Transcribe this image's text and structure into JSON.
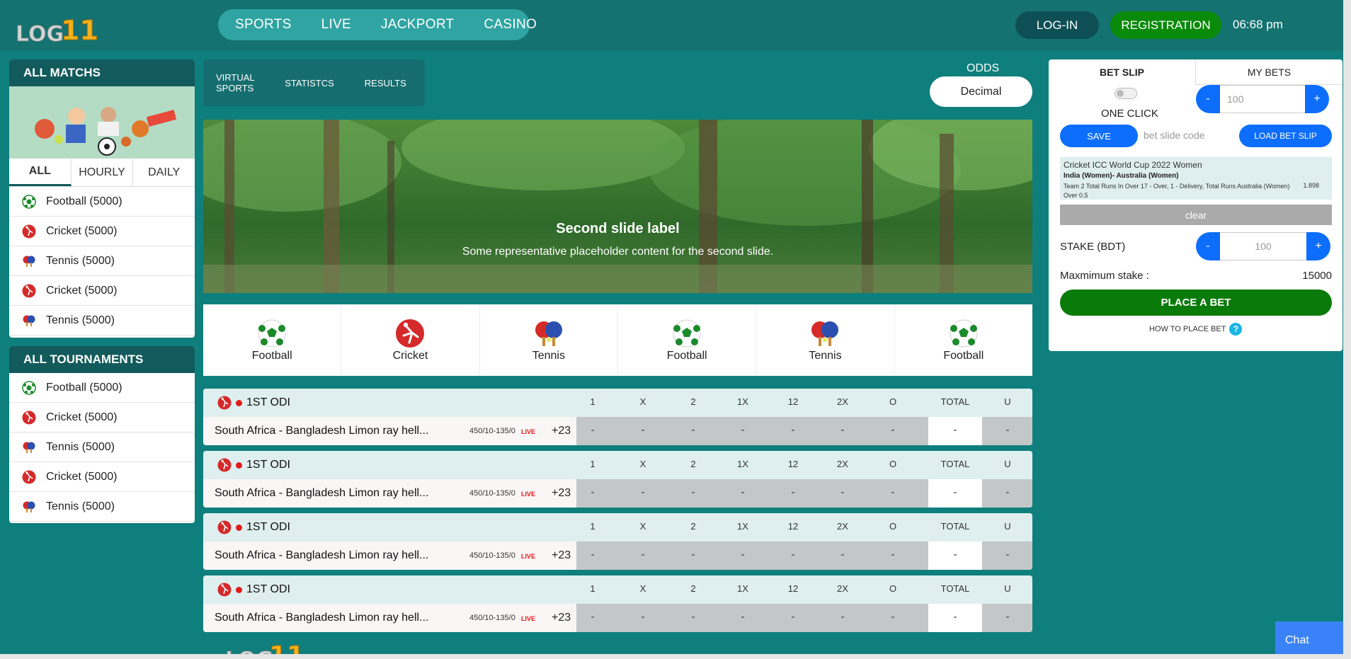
{
  "header": {
    "logo_text": "LOG11",
    "nav": [
      "SPORTS",
      "LIVE",
      "JACKPORT",
      "CASINO"
    ],
    "login": "LOG-IN",
    "register": "REGISTRATION",
    "time": "06:68 pm"
  },
  "sidebar": {
    "all_matchs": {
      "title": "ALL MATCHS",
      "tabs": [
        "ALL",
        "HOURLY",
        "DAILY"
      ],
      "items": [
        "Football (5000)",
        "Cricket (5000)",
        "Tennis (5000)",
        "Cricket (5000)",
        "Tennis (5000)"
      ]
    },
    "all_tournaments": {
      "title": "ALL TOURNAMENTS",
      "items": [
        "Football (5000)",
        "Cricket (5000)",
        "Tennis (5000)",
        "Cricket (5000)",
        "Tennis (5000)"
      ]
    }
  },
  "subtabs": [
    "VIRTUAL SPORTS",
    "STATISTCS",
    "RESULTS"
  ],
  "odds": {
    "label": "ODDS",
    "value": "Decimal"
  },
  "banner": {
    "title": "Second slide label",
    "subtitle": "Some representative placeholder content for the second slide."
  },
  "sports_bar": [
    {
      "label": "Football",
      "icon": "football-icon"
    },
    {
      "label": "Cricket",
      "icon": "cricket-icon"
    },
    {
      "label": "Tennis",
      "icon": "tennis-icon"
    },
    {
      "label": "Football",
      "icon": "football-icon"
    },
    {
      "label": "Tennis",
      "icon": "tennis-icon"
    },
    {
      "label": "Football",
      "icon": "football-icon"
    }
  ],
  "match_columns": [
    "1",
    "X",
    "2",
    "1X",
    "12",
    "2X",
    "O",
    "TOTAL",
    "U"
  ],
  "matches": [
    {
      "title": "1ST ODI",
      "name": "South Africa - Bangladesh Limon ray hell...",
      "score": "450/10-135/0",
      "live": "LIVE",
      "more": "+23",
      "odds": [
        "-",
        "-",
        "-",
        "-",
        "-",
        "-",
        "-",
        "-",
        "-"
      ]
    },
    {
      "title": "1ST ODI",
      "name": "South Africa - Bangladesh Limon ray hell...",
      "score": "450/10-135/0",
      "live": "LIVE",
      "more": "+23",
      "odds": [
        "-",
        "-",
        "-",
        "-",
        "-",
        "-",
        "-",
        "-",
        "-"
      ]
    },
    {
      "title": "1ST ODI",
      "name": "South Africa - Bangladesh Limon ray hell...",
      "score": "450/10-135/0",
      "live": "LIVE",
      "more": "+23",
      "odds": [
        "-",
        "-",
        "-",
        "-",
        "-",
        "-",
        "-",
        "-",
        "-"
      ]
    },
    {
      "title": "1ST ODI",
      "name": "South Africa - Bangladesh Limon ray hell...",
      "score": "450/10-135/0",
      "live": "LIVE",
      "more": "+23",
      "odds": [
        "-",
        "-",
        "-",
        "-",
        "-",
        "-",
        "-",
        "-",
        "-"
      ]
    }
  ],
  "betslip": {
    "tab_betslip": "BET SLIP",
    "tab_mybets": "MY BETS",
    "one_click": "ONE CLICK",
    "stepper_minus": "-",
    "stepper_plus": "+",
    "one_click_amount": "100",
    "save": "SAVE",
    "code_placeholder": "bet slide code",
    "load": "LOAD BET SLIP",
    "bet": {
      "league": "Cricket ICC World Cup 2022 Women",
      "teams": "India (Women)- Australia (Women)",
      "market": "Team 2 Total Runs In Over 17 - Over, 1 - Delivery, Total Runs Australia (Women) Over 0.5",
      "odd": "1.898"
    },
    "clear": "clear",
    "stake_label": "STAKE (BDT)",
    "stake_amount": "100",
    "max_label": "Maxmimum stake :",
    "max_value": "15000",
    "place": "PLACE A BET",
    "howto": "HOW TO PLACE BET",
    "help": "?"
  },
  "chat": "Chat",
  "colors": {
    "bg": "#0e7f7d",
    "header": "#147270",
    "accent_blue": "#0d6efd",
    "accent_green": "#0a7a0a"
  }
}
